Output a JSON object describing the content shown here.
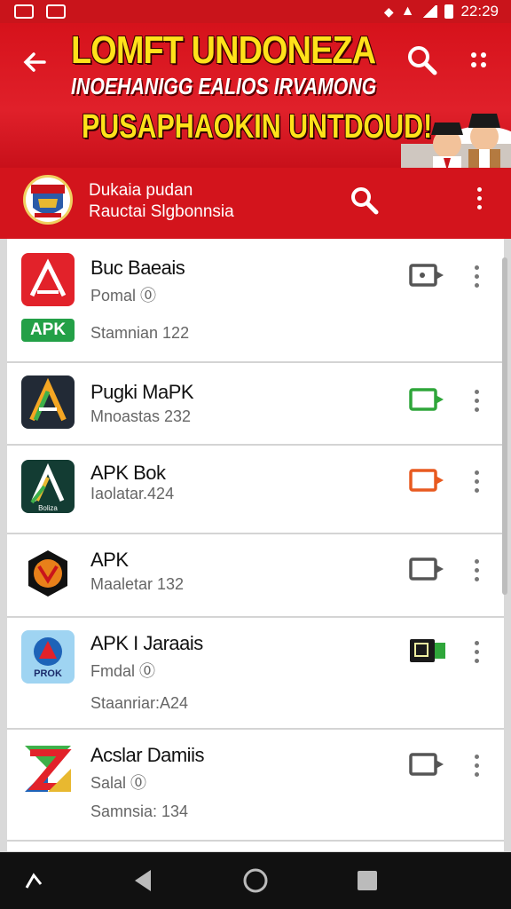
{
  "status_bar": {
    "time": "22:29"
  },
  "banner": {
    "title": "LOMFT UNDONEZA",
    "subtitle": "INOEHANIGG EALIOS IRVAMONG",
    "slogan": "PUSAPHAOKIN UNTDOUD!"
  },
  "sub_header": {
    "line1": "Dukaia pudan",
    "line2": "Rauctai Slgbonnsia"
  },
  "apps": [
    {
      "name": "Buc Baeais",
      "sub": "Pomal ⓪",
      "badge": "APK",
      "stat": "Stamnian 122",
      "action_color": "#555555"
    },
    {
      "name": "Pugki MaPK",
      "sub": "Mnoastas 232",
      "action_color": "#2fa63a"
    },
    {
      "name": "APK Bok",
      "sub": "Iaolatar.424",
      "action_color": "#e85a20"
    },
    {
      "name": "APK",
      "sub": "Maaletar 132",
      "action_color": "#555555"
    },
    {
      "name": "APK I Jaraais",
      "sub": "Fmdal ⓪",
      "stat": "Staanriar:A24",
      "action_color": "#1a1a1a"
    },
    {
      "name": "Acslar Damiis",
      "sub": "Salal ⓪",
      "stat": "Samnsia: 134",
      "action_color": "#555555"
    }
  ],
  "icons": {
    "app2": "A",
    "app3_label": "Boliza",
    "app5_label": "PROK"
  },
  "colors": {
    "primary_red": "#d3141c",
    "banner_yellow": "#ffe21a",
    "apk_green": "#23a047"
  }
}
